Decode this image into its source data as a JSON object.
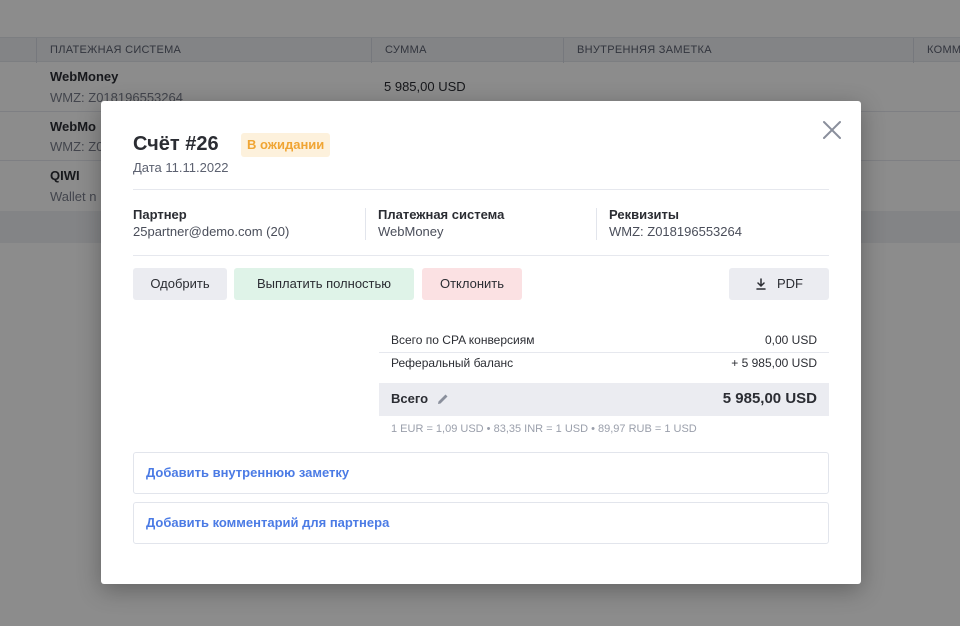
{
  "background": {
    "columns": [
      "ПЛАТЕЖНАЯ СИСТЕМА",
      "СУММА",
      "ВНУТРЕННЯЯ ЗАМЕТКА",
      "КОММ"
    ],
    "rows": [
      {
        "name": "WebMoney",
        "sub": "WMZ:   Z018196553264",
        "amount": "5 985,00 USD"
      },
      {
        "name": "WebMo",
        "sub": "WMZ:   Z0",
        "amount": ""
      },
      {
        "name": "QIWI",
        "sub": "Wallet n",
        "amount": ""
      }
    ]
  },
  "modal": {
    "title": "Счёт #26",
    "status": "В ожидании",
    "date": "Дата  11.11.2022",
    "partner": {
      "label": "Партнер",
      "value": "25partner@demo.com (20)"
    },
    "payment_system": {
      "label": "Платежная система",
      "value": "WebMoney"
    },
    "requisites": {
      "label": "Реквизиты",
      "value": "WMZ:   Z018196553264"
    },
    "buttons": {
      "approve": "Одобрить",
      "pay_full": "Выплатить полностью",
      "reject": "Отклонить",
      "pdf": "PDF"
    },
    "summary": {
      "cpa_label": "Всего по CPA конверсиям",
      "cpa_value": "0,00 USD",
      "ref_label": "Реферальный баланс",
      "ref_value": "+ 5 985,00 USD",
      "total_label": "Всего",
      "total_value": "5 985,00 USD",
      "rates": "1 EUR = 1,09 USD • 83,35 INR = 1 USD • 89,97 RUB = 1 USD"
    },
    "add_note": "Добавить внутреннюю заметку",
    "add_comment": "Добавить комментарий для партнера"
  },
  "colors": {
    "status_badge_bg": "#fdf1dc",
    "status_badge_text": "#f0a534",
    "link": "#4b7be5",
    "approve_bg": "#ebecf1",
    "pay_full_bg": "#dff3e8",
    "reject_bg": "#fbe1e3"
  }
}
